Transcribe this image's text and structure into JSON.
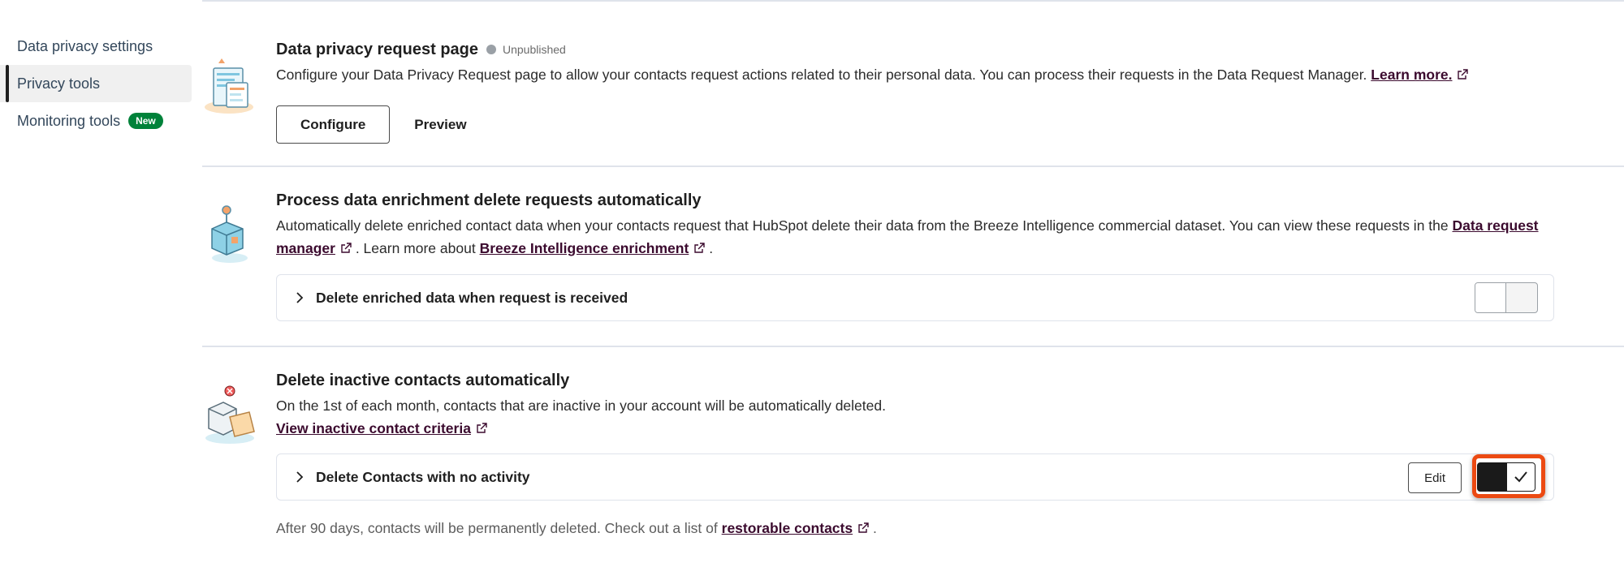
{
  "sidebar": {
    "items": [
      {
        "label": "Data privacy settings"
      },
      {
        "label": "Privacy tools"
      },
      {
        "label": "Monitoring tools",
        "badge": "New"
      }
    ]
  },
  "request_page": {
    "title": "Data privacy request page",
    "status": "Unpublished",
    "description": "Configure your Data Privacy Request page to allow your contacts request actions related to their personal data. You can process their requests in the Data Request Manager.",
    "learn_more": "Learn more.",
    "configure_label": "Configure",
    "preview_label": "Preview"
  },
  "enrichment": {
    "title": "Process data enrichment delete requests automatically",
    "description": "Automatically delete enriched contact data when your contacts request that HubSpot delete their data from the Breeze Intelligence commercial dataset. You can view these requests in the",
    "link_request_manager": "Data request manager",
    "learn_more_text": ". Learn more about",
    "link_breeze": "Breeze Intelligence enrichment",
    "period": ".",
    "panel_label": "Delete enriched data when request is received",
    "toggle_on": false
  },
  "inactive": {
    "title": "Delete inactive contacts automatically",
    "description": "On the 1st of each month, contacts that are inactive in your account will be automatically deleted.",
    "criteria_link": "View inactive contact criteria",
    "panel_label": "Delete Contacts with no activity",
    "edit_label": "Edit",
    "toggle_on": true,
    "note_prefix": "After 90 days, contacts will be permanently deleted. Check out a list of",
    "note_link": "restorable contacts",
    "note_suffix": "."
  },
  "colors": {
    "link": "#3b0a2e",
    "badge": "#00823a",
    "highlight": "#ec4a12"
  }
}
